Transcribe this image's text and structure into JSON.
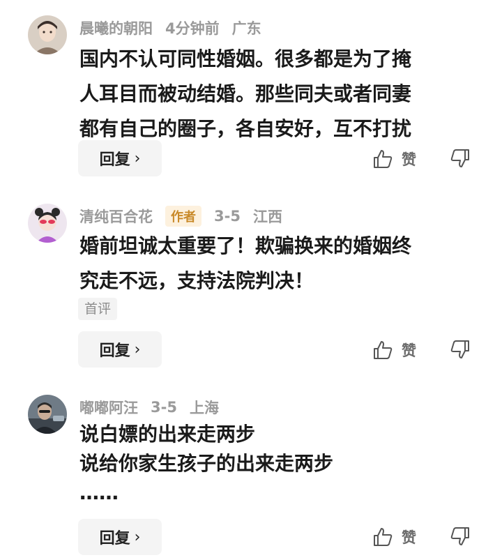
{
  "comments": [
    {
      "username": "晨曦的朝阳",
      "time": "4分钟前",
      "location": "广东",
      "badge": "",
      "lines": [
        "国内不认可同性婚姻。很多都是为了掩",
        "人耳目而被动结婚。那些同夫或者同妻",
        "都有自己的圈子，各自安好，互不打扰"
      ],
      "tag": "",
      "reply_label": "回复",
      "like_label": "赞",
      "avatar_icon": "avatar-boy-portrait"
    },
    {
      "username": "清纯百合花",
      "time": "3-5",
      "location": "江西",
      "badge": "作者",
      "lines": [
        "婚前坦诚太重要了！欺骗换来的婚姻终",
        "究走不远，支持法院判决！"
      ],
      "tag": "首评",
      "reply_label": "回复",
      "like_label": "赞",
      "avatar_icon": "avatar-girl-cartoon"
    },
    {
      "username": "嘟嘟阿汪",
      "time": "3-5",
      "location": "上海",
      "badge": "",
      "lines": [
        "说白嫖的出来走两步",
        "说给你家生孩子的出来走两步",
        "……"
      ],
      "tag": "",
      "reply_label": "回复",
      "like_label": "赞",
      "avatar_icon": "avatar-man-dark"
    }
  ],
  "colors": {
    "meta_text": "#9a9a9a",
    "badge_bg": "#fdf1de",
    "badge_text": "#c98a2a",
    "button_bg": "#f4f4f4"
  }
}
